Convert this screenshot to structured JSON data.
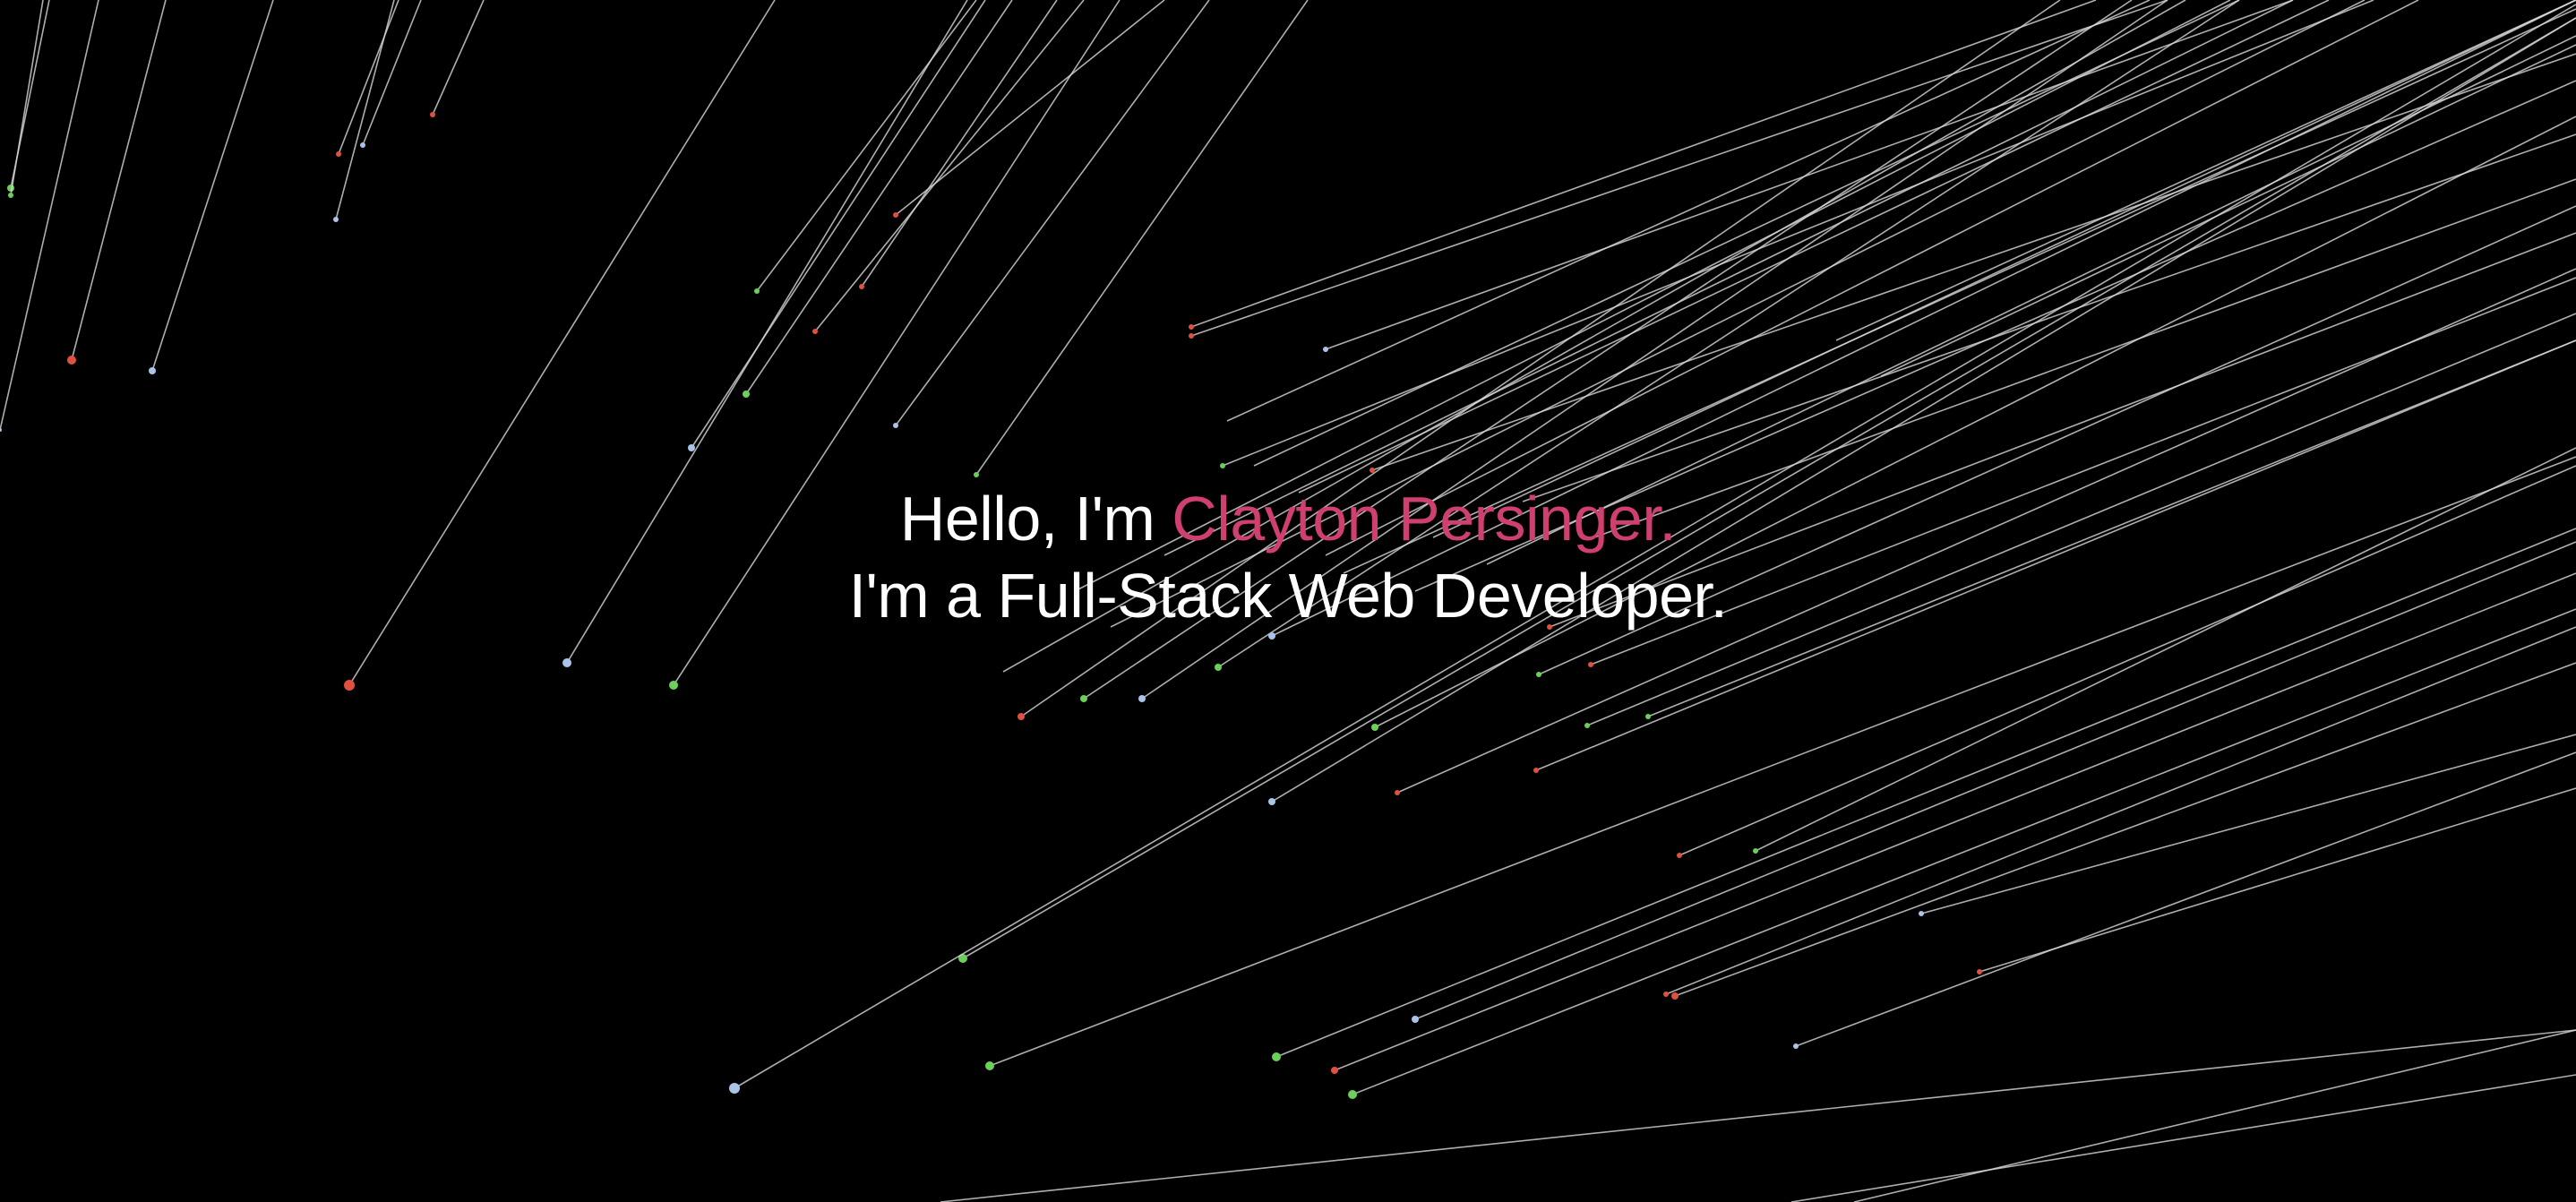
{
  "hero": {
    "greeting": "Hello, I'm ",
    "name": "Clayton Persinger.",
    "tagline": "I'm a Full-Stack Web Developer."
  },
  "colors": {
    "background": "#000000",
    "text": "#ffffff",
    "accent": "#cf3f70",
    "trail": "#d9d9d9",
    "particle_red": "#e0503f",
    "particle_green": "#6ccf5a",
    "particle_blue": "#a9c4e8"
  },
  "animation": {
    "type": "starfield-warp"
  }
}
